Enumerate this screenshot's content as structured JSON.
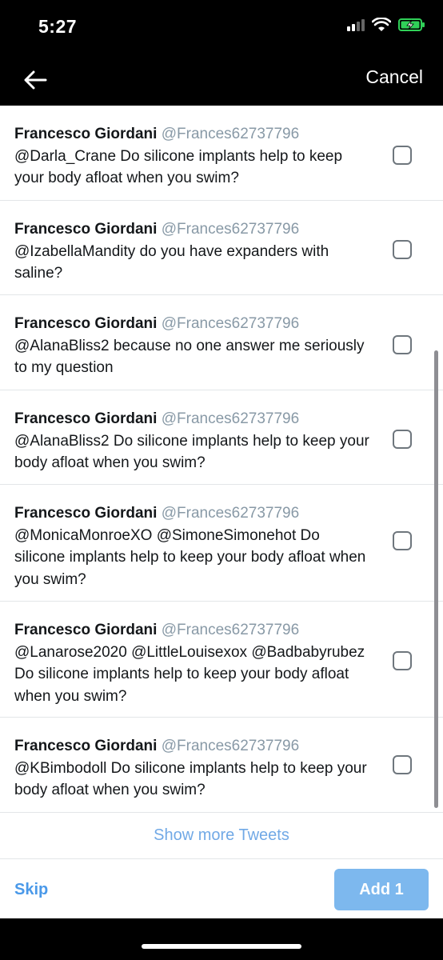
{
  "status_bar": {
    "time": "5:27",
    "icons": [
      "signal-icon",
      "wifi-icon",
      "battery-charging-icon"
    ],
    "battery_color": "#30d158"
  },
  "nav": {
    "back_icon": "back-arrow-icon",
    "cancel_label": "Cancel"
  },
  "tweets": [
    {
      "author": "Francesco Giordani",
      "handle": "@Frances62737796",
      "text": "@Darla_Crane Do silicone implants help to keep your body afloat when you swim?",
      "checked": false
    },
    {
      "author": "Francesco Giordani",
      "handle": "@Frances62737796",
      "text": "@IzabellaMandity do you have expanders with saline?",
      "checked": false
    },
    {
      "author": "Francesco Giordani",
      "handle": "@Frances62737796",
      "text": "@AlanaBliss2 because no one answer me seriously to my question",
      "checked": false
    },
    {
      "author": "Francesco Giordani",
      "handle": "@Frances62737796",
      "text": "@AlanaBliss2 Do silicone implants help to keep your body afloat when you swim?",
      "checked": false
    },
    {
      "author": "Francesco Giordani",
      "handle": "@Frances62737796",
      "text": "@MonicaMonroeXO @SimoneSimonehot Do silicone implants help to keep your body afloat when you swim?",
      "checked": false
    },
    {
      "author": "Francesco Giordani",
      "handle": "@Frances62737796",
      "text": "@Lanarose2020 @LittleLouisexox @Badbabyrubez Do silicone implants help to keep your body afloat when you swim?",
      "checked": false
    },
    {
      "author": "Francesco Giordani",
      "handle": "@Frances62737796",
      "text": "@KBimbodoll Do silicone implants help to keep your body afloat when you swim?",
      "checked": false
    }
  ],
  "show_more_label": "Show more Tweets",
  "footer": {
    "skip_label": "Skip",
    "add_label": "Add 1"
  },
  "colors": {
    "link_blue": "#4a99e9",
    "handle_gray": "#8899a6",
    "add_button": "#7db8ee"
  }
}
